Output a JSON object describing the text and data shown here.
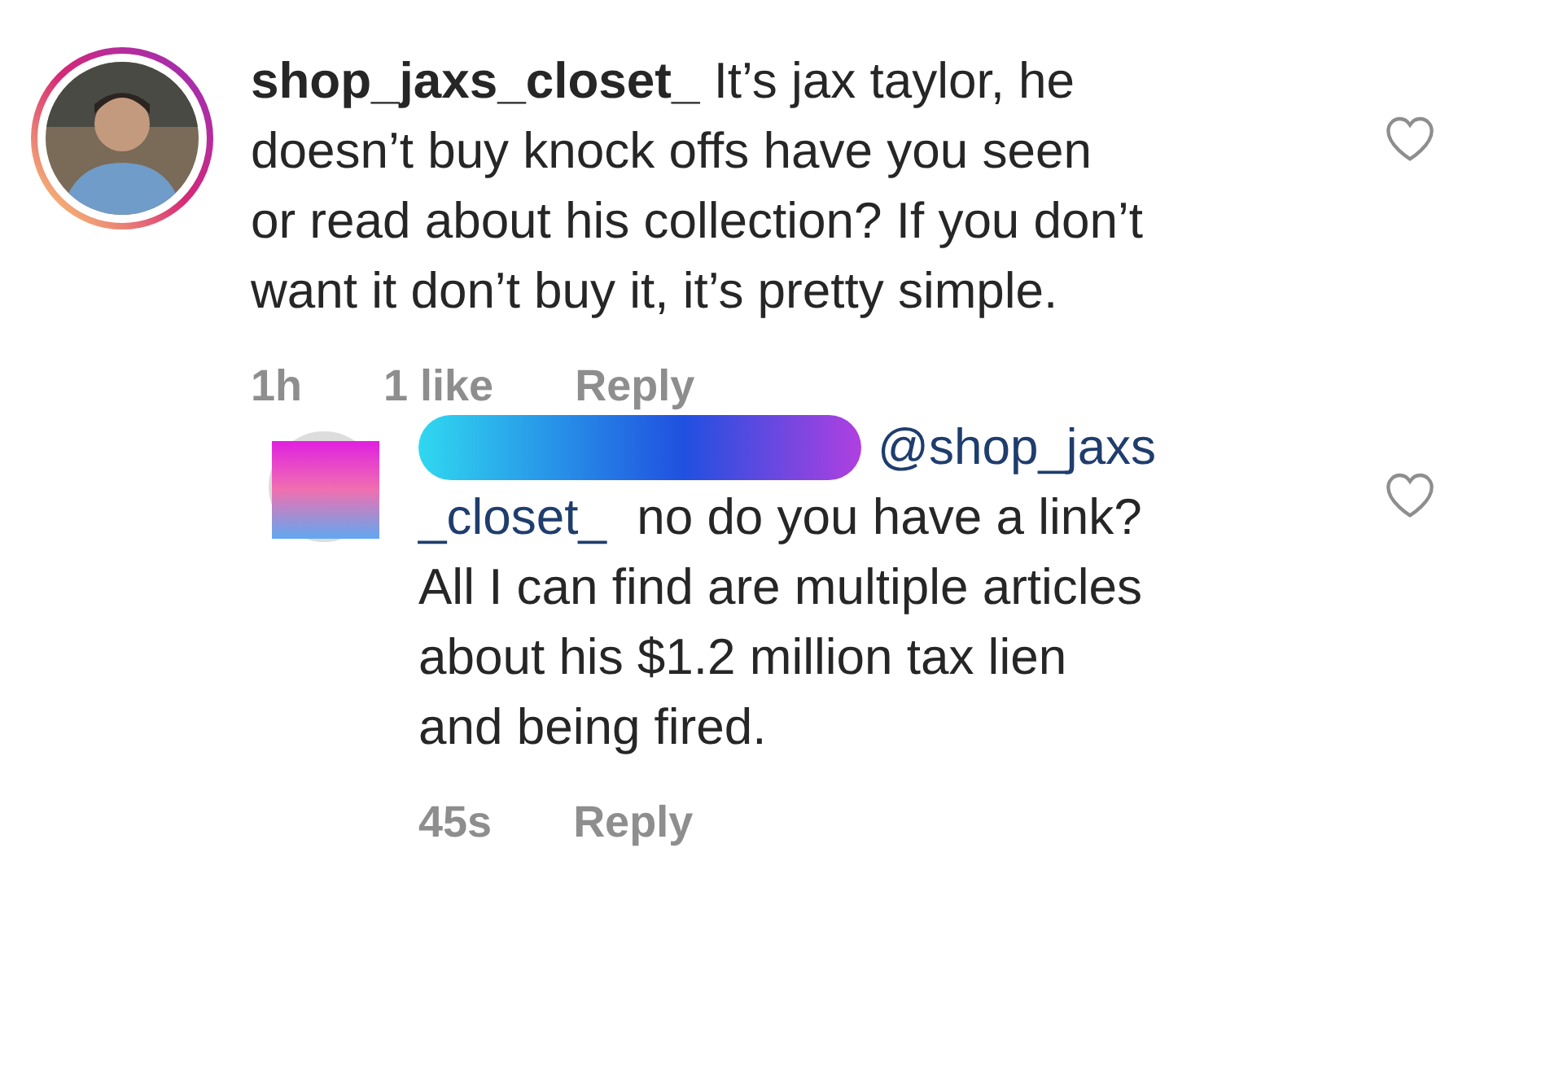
{
  "comments": [
    {
      "kind": "story",
      "username": "shop_jaxs_closet_",
      "lines": [
        "It’s jax taylor, he",
        "doesn’t buy knock offs have you seen",
        "or read about his collection? If you don’t",
        "want it don’t buy it, it’s pretty simple."
      ],
      "time": "1h",
      "likes": "1 like",
      "reply": "Reply",
      "liked": false
    },
    {
      "kind": "redacted",
      "mention": [
        "@shop_jaxs",
        "_closet_"
      ],
      "lines": [
        "no do you have a link?",
        "All I can find are multiple articles",
        "about his $1.2 million tax lien",
        "and being fired."
      ],
      "time": "45s",
      "reply": "Reply",
      "liked": false
    }
  ]
}
